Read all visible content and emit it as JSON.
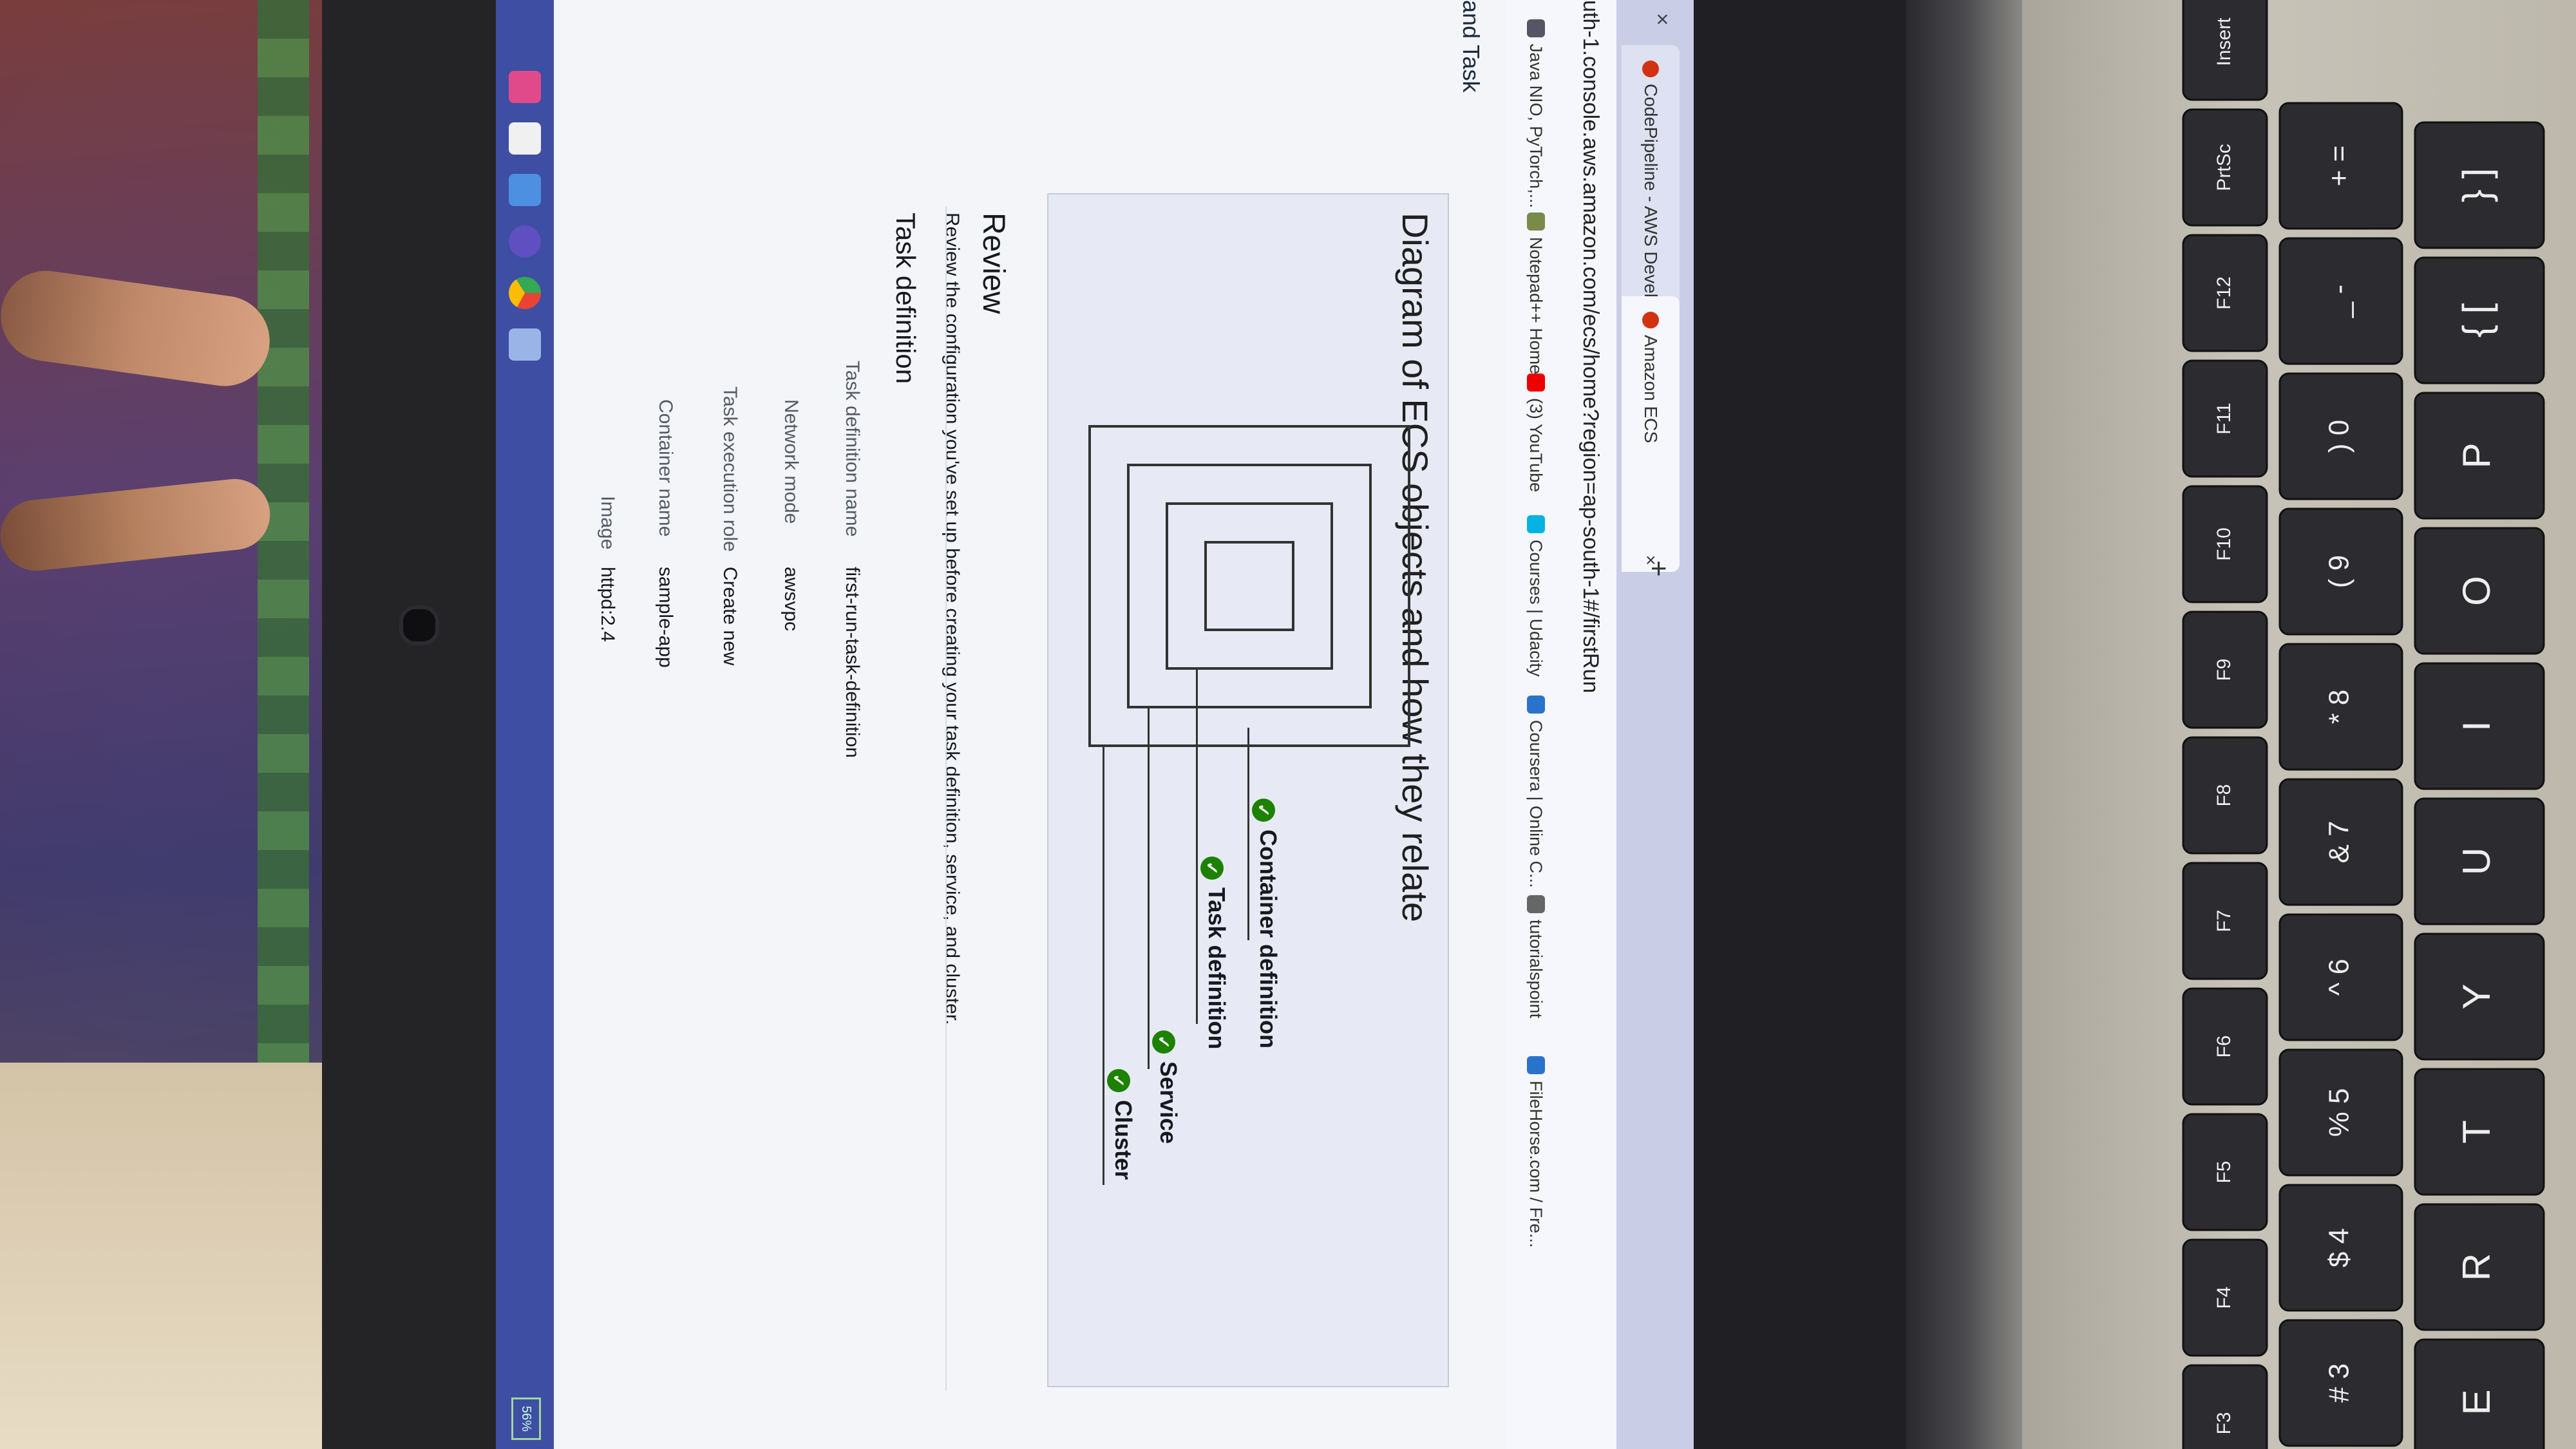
{
  "browser": {
    "tabs": [
      {
        "label": "CodePipeline - AWS Developer T",
        "close": "×"
      },
      {
        "label": "Amazon ECS",
        "close": "×"
      }
    ],
    "tab_close_left": "×",
    "new_tab": "+",
    "url": "uth-1.console.aws.amazon.com/ecs/home?region=ap-south-1#/firstRun",
    "bookmarks": [
      "Java NIO, PyTorch,...",
      "Notepad++ Home",
      "(3) YouTube",
      "Courses | Udacity",
      "Coursera | Online C...",
      "tutorialspoint",
      "FileHorse.com / Fre..."
    ]
  },
  "page": {
    "breadcrumb_fragment": "and Task",
    "diagram": {
      "title": "Diagram of ECS objects and how they relate",
      "legend": [
        "Container definition",
        "Task definition",
        "Service",
        "Cluster"
      ],
      "check_icon": "✓"
    },
    "review": {
      "heading": "Review",
      "description": "Review the configuration you've set up before creating your task definition, service, and cluster.",
      "section_title": "Task definition",
      "rows": [
        {
          "label": "Task definition name",
          "value": "first-run-task-definition"
        },
        {
          "label": "Network mode",
          "value": "awsvpc"
        },
        {
          "label": "Task execution role",
          "value": "Create new"
        },
        {
          "label": "Container name",
          "value": "sample-app"
        },
        {
          "label": "Image",
          "value": "httpd:2.4"
        }
      ]
    }
  },
  "taskbar": {
    "battery": "56%",
    "icons": [
      "windows-store-icon",
      "mail-icon",
      "file-explorer-icon",
      "settings-icon",
      "chrome-icon",
      "app-icon"
    ]
  },
  "keyboard": {
    "fn_row": [
      "F3",
      "F4",
      "F5",
      "F6",
      "F7",
      "F8",
      "F9",
      "F10",
      "F11",
      "F12",
      "PrtSc",
      "Insert"
    ],
    "number_row": [
      "#\n3",
      "$\n4",
      "%\n5",
      "^\n6",
      "&\n7",
      "*\n8",
      "(\n9",
      ")\n0",
      "_\n-",
      "+\n="
    ],
    "letter_row": [
      "E",
      "R",
      "T",
      "Y",
      "U",
      "I",
      "O",
      "P",
      "{\n[",
      "}\n]"
    ]
  },
  "colors": {
    "aws_green": "#1d8102",
    "tabbar": "#c9cde6",
    "taskbar": "#3d4ea3"
  }
}
